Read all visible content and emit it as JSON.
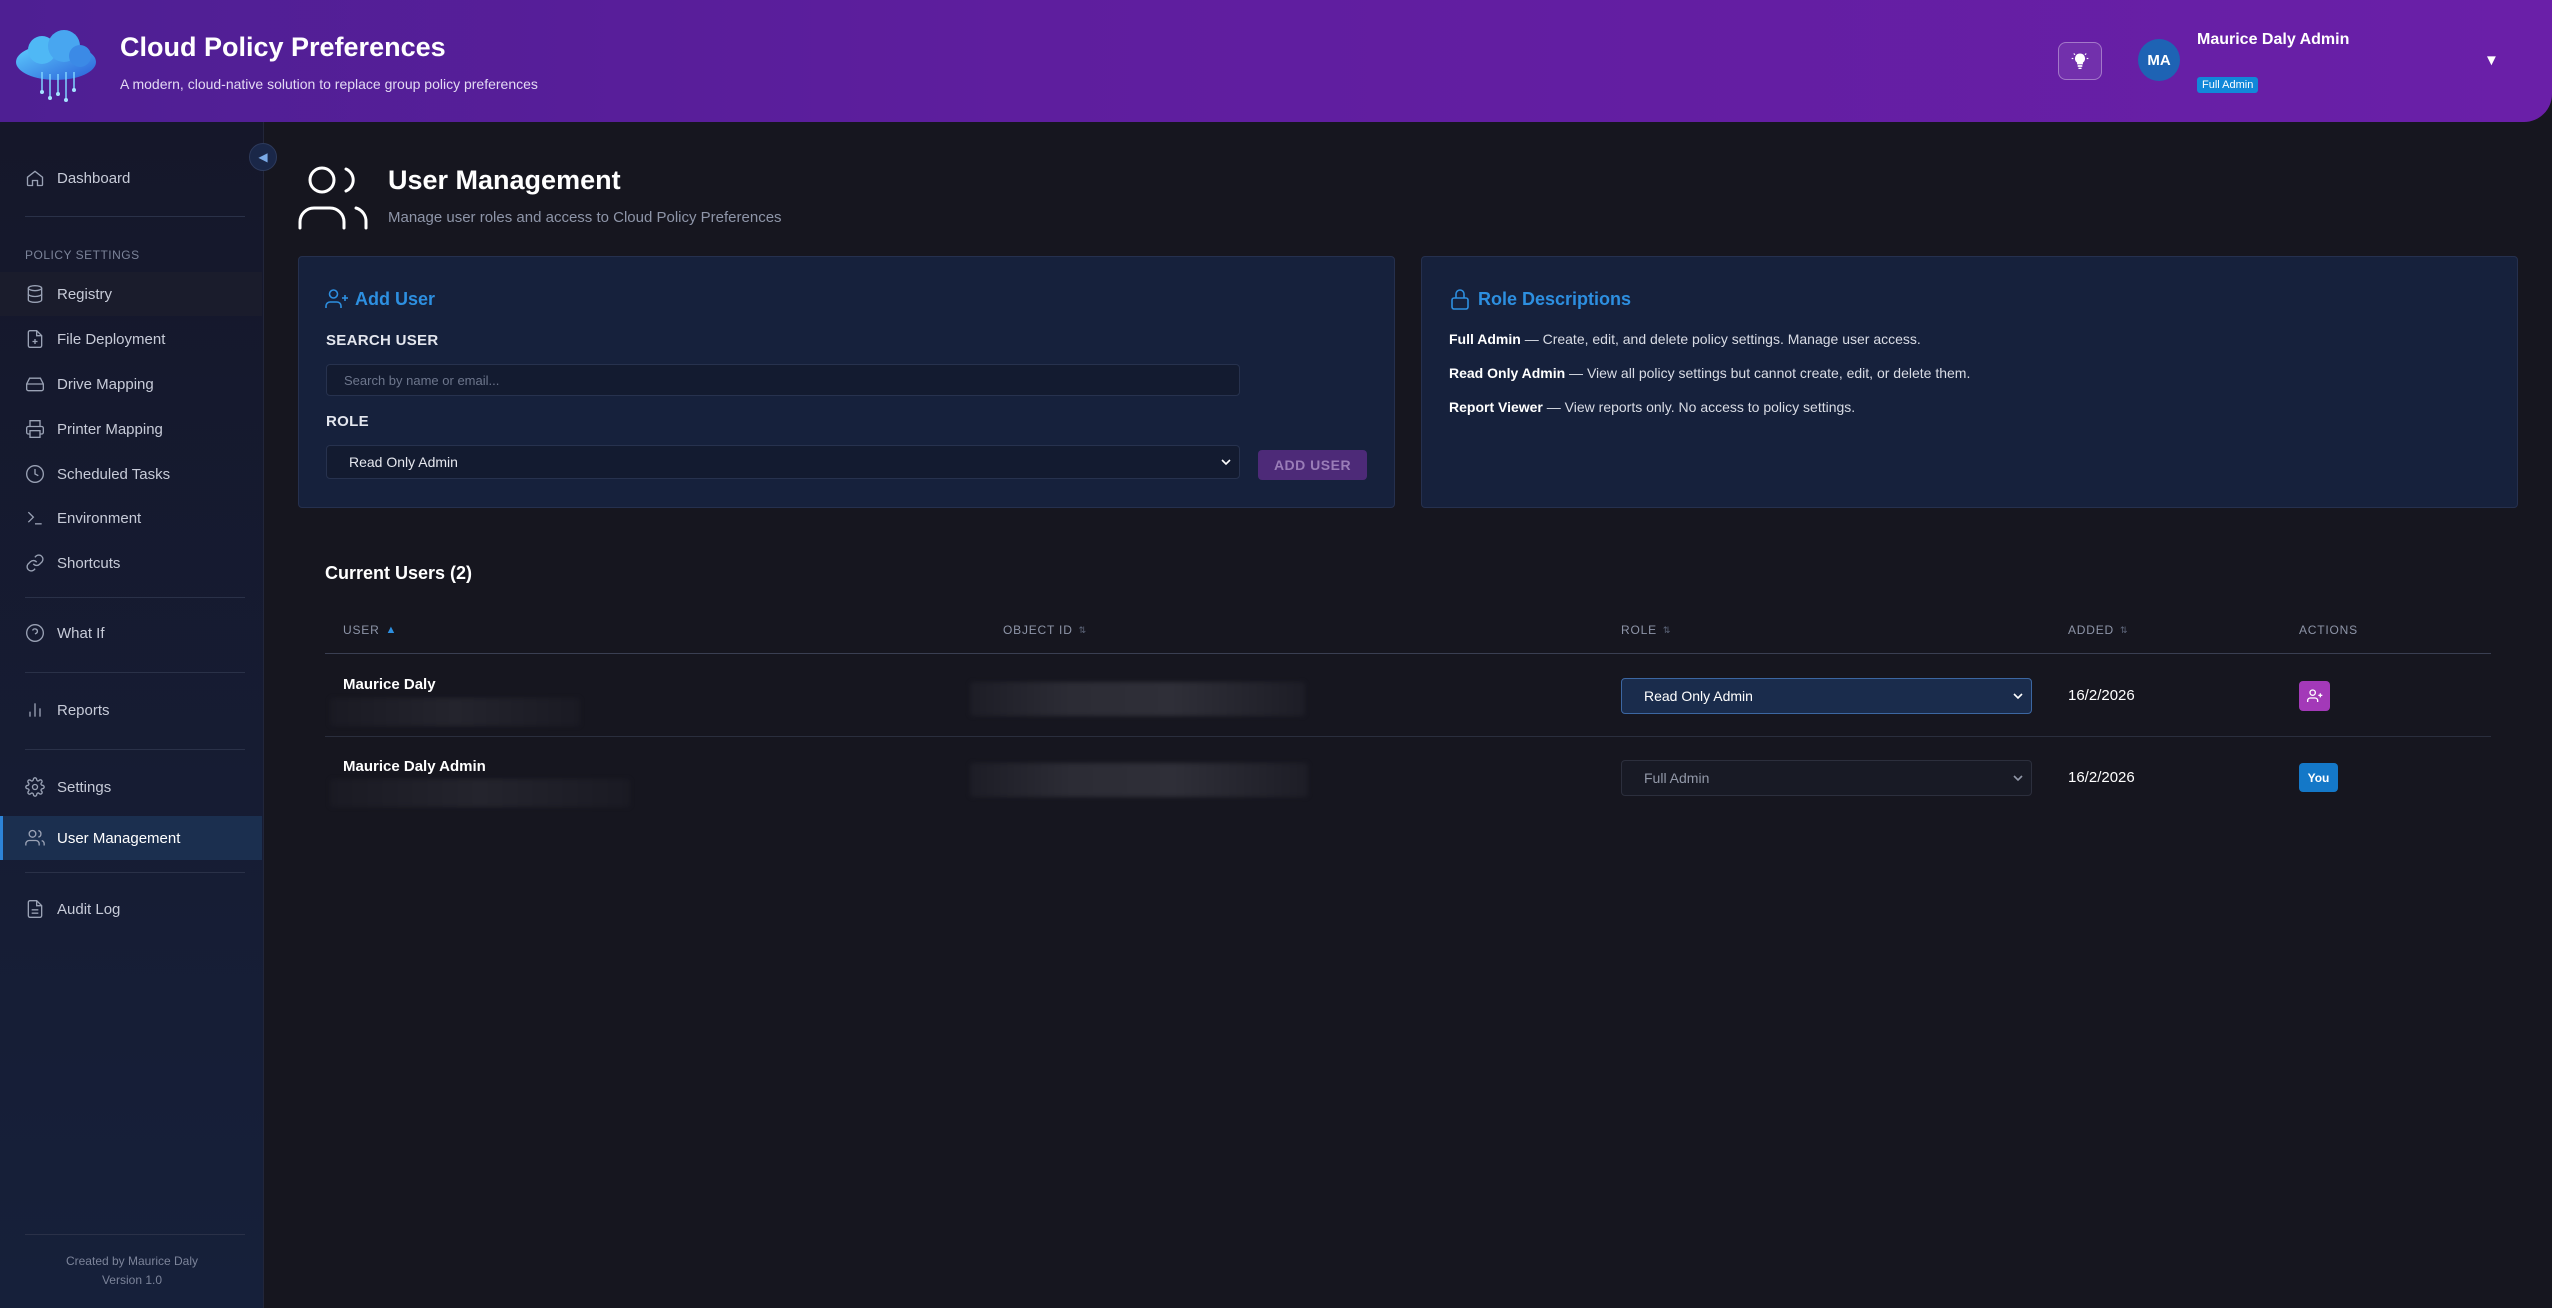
{
  "header": {
    "title": "Cloud Policy Preferences",
    "subtitle": "A modern, cloud-native solution to replace group policy preferences",
    "user": {
      "initials": "MA",
      "name": "Maurice Daly Admin",
      "badge": "Full Admin"
    },
    "brand_color": "#5e1e9e"
  },
  "sidebar": {
    "section_label": "POLICY SETTINGS",
    "items": [
      {
        "label": "Dashboard",
        "icon": "home-icon"
      },
      {
        "label": "Registry",
        "icon": "database-icon"
      },
      {
        "label": "File Deployment",
        "icon": "file-plus-icon"
      },
      {
        "label": "Drive Mapping",
        "icon": "hard-drive-icon"
      },
      {
        "label": "Printer Mapping",
        "icon": "printer-icon"
      },
      {
        "label": "Scheduled Tasks",
        "icon": "clock-icon"
      },
      {
        "label": "Environment",
        "icon": "terminal-icon"
      },
      {
        "label": "Shortcuts",
        "icon": "link-icon"
      },
      {
        "label": "What If",
        "icon": "help-circle-icon"
      },
      {
        "label": "Reports",
        "icon": "bar-chart-icon"
      },
      {
        "label": "Settings",
        "icon": "gear-icon"
      },
      {
        "label": "User Management",
        "icon": "users-icon"
      },
      {
        "label": "Audit Log",
        "icon": "file-text-icon"
      }
    ],
    "active": "User Management",
    "credits": {
      "line1": "Created by Maurice Daly",
      "line2": "Version 1.0"
    }
  },
  "page": {
    "title": "User Management",
    "subtitle": "Manage user roles and access to Cloud Policy Preferences"
  },
  "add_user": {
    "title": "Add User",
    "search_label": "SEARCH USER",
    "search_placeholder": "Search by name or email...",
    "role_label": "ROLE",
    "role_value": "Read Only Admin",
    "button_label": "ADD USER"
  },
  "roles": {
    "title": "Role Descriptions",
    "items": [
      {
        "name": "Full Admin",
        "desc": " — Create, edit, and delete policy settings. Manage user access."
      },
      {
        "name": "Read Only Admin",
        "desc": " — View all policy settings but cannot create, edit, or delete them."
      },
      {
        "name": "Report Viewer",
        "desc": " — View reports only. No access to policy settings."
      }
    ]
  },
  "users_table": {
    "title": "Current Users (2)",
    "columns": [
      "USER",
      "OBJECT ID",
      "ROLE",
      "ADDED",
      "ACTIONS"
    ],
    "rows": [
      {
        "name": "Maurice Daly",
        "role": "Read Only Admin",
        "added": "16/2/2026",
        "action": "add-user-icon"
      },
      {
        "name": "Maurice Daly Admin",
        "role": "Full Admin",
        "added": "16/2/2026",
        "action_label": "You"
      }
    ]
  }
}
